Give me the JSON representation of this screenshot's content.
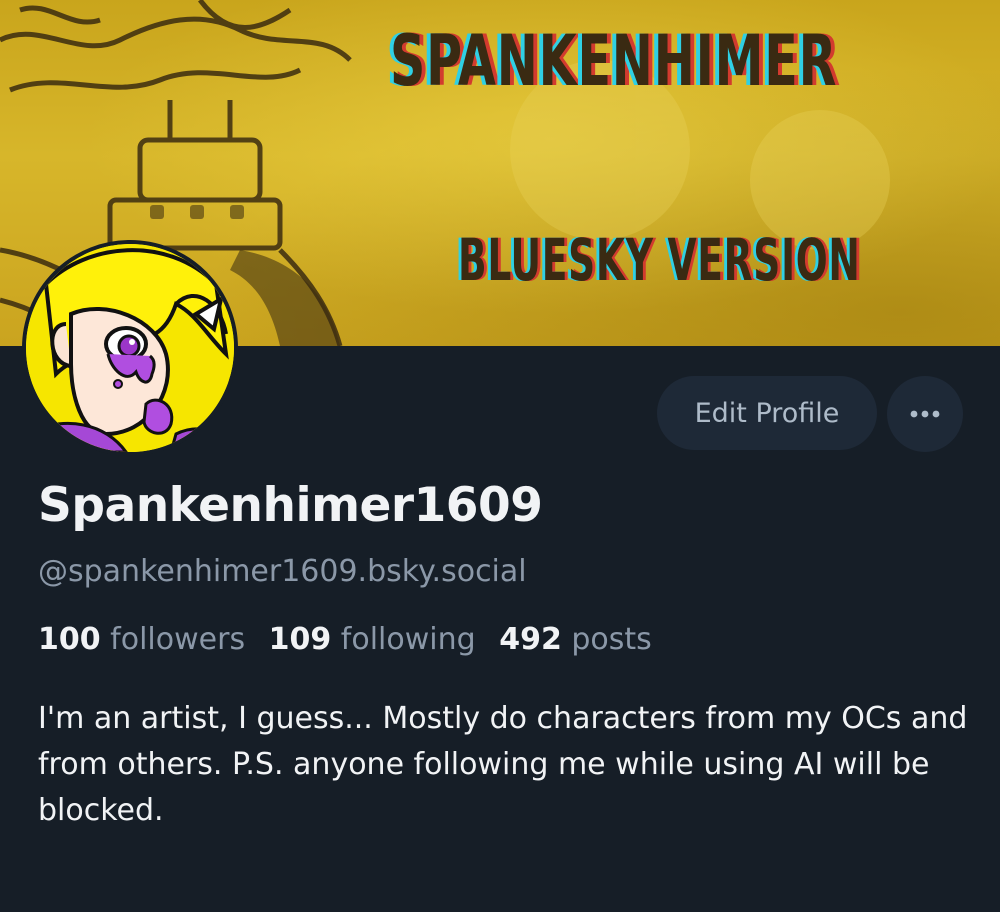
{
  "banner": {
    "title": "SPANKENHIMER",
    "subtitle": "BLUESKY VERSION"
  },
  "actions": {
    "edit_label": "Edit Profile",
    "more_icon": "ellipsis-icon"
  },
  "profile": {
    "display_name": "Spankenhimer1609",
    "handle": "@spankenhimer1609.bsky.social",
    "bio": "I'm an artist, I guess... Mostly do characters from my OCs and from others. P.S. anyone following me while using AI will be blocked."
  },
  "stats": {
    "followers_count": "100",
    "followers_label": "followers",
    "following_count": "109",
    "following_label": "following",
    "posts_count": "492",
    "posts_label": "posts"
  },
  "colors": {
    "background": "#161e27",
    "button_bg": "#1e2937",
    "banner_yellow": "#d4b126",
    "text_primary": "#f1f3f5",
    "text_secondary": "#8b98a8"
  }
}
